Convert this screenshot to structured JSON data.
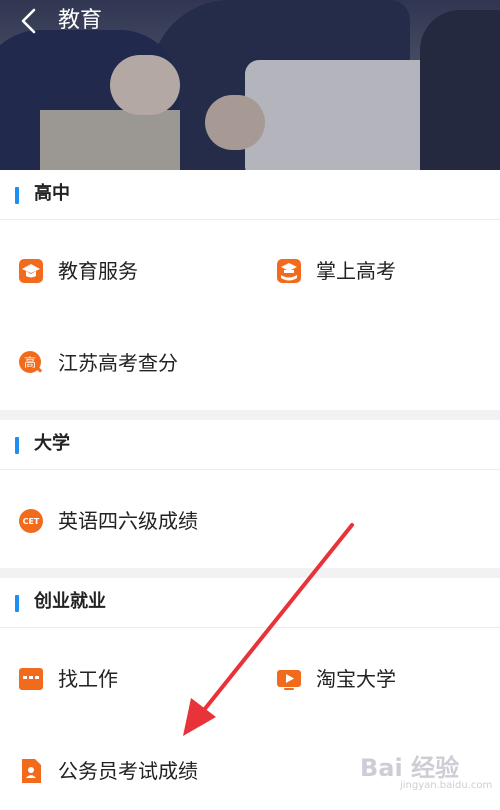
{
  "header": {
    "title": "教育",
    "back_icon": "chevron-left-icon"
  },
  "sections": [
    {
      "title": "高中",
      "accent": "#1f8ef1",
      "items": [
        {
          "label": "教育服务",
          "icon": "graduation-cap-icon",
          "color": "#f26b1d"
        },
        {
          "label": "掌上高考",
          "icon": "book-icon",
          "color": "#f26b1d"
        },
        {
          "label": "江苏高考查分",
          "icon": "gaokao-search-icon",
          "color": "#f26b1d",
          "icon_text": "高"
        }
      ]
    },
    {
      "title": "大学",
      "accent": "#1f8ef1",
      "items": [
        {
          "label": "英语四六级成绩",
          "icon": "cet-icon",
          "color": "#f26b1d",
          "icon_text": "CET"
        }
      ]
    },
    {
      "title": "创业就业",
      "accent": "#1f8ef1",
      "items": [
        {
          "label": "找工作",
          "icon": "job-icon",
          "color": "#f26b1d"
        },
        {
          "label": "淘宝大学",
          "icon": "video-play-icon",
          "color": "#f26b1d"
        },
        {
          "label": "公务员考试成绩",
          "icon": "document-person-icon",
          "color": "#f26b1d"
        }
      ]
    }
  ],
  "annotation": {
    "arrow_color": "#e8333a"
  },
  "watermark": {
    "text": "Bai 经验",
    "sub": "jingyan.baidu.com"
  }
}
